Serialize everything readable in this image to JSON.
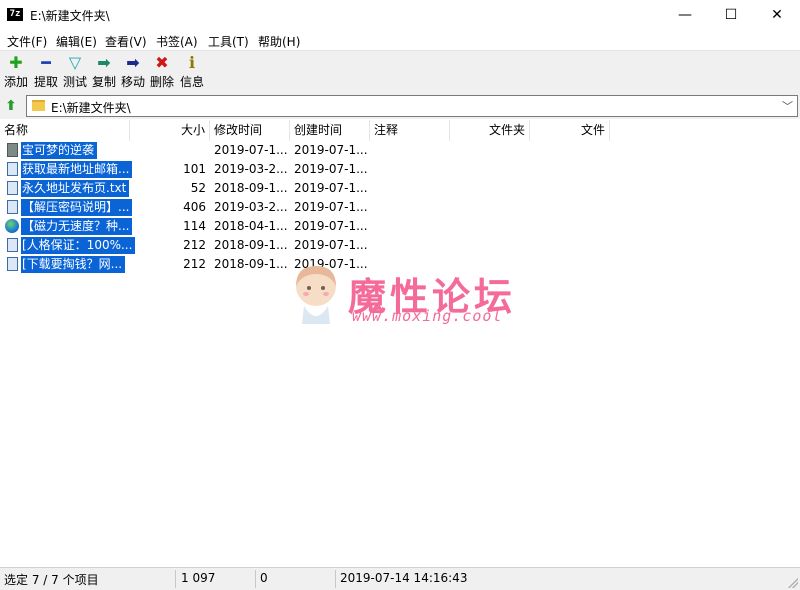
{
  "window": {
    "app_icon_text": "7z",
    "title": "E:\\新建文件夹\\",
    "controls": {
      "minimize": "—",
      "maximize": "☐",
      "close": "✕"
    }
  },
  "menu": [
    "文件(F)",
    "编辑(E)",
    "查看(V)",
    "书签(A)",
    "工具(T)",
    "帮助(H)"
  ],
  "toolbar": [
    {
      "label": "添加",
      "icon": "add-icon",
      "glyph": "✚",
      "color": "#1fa31f"
    },
    {
      "label": "提取",
      "icon": "extract-icon",
      "glyph": "━",
      "color": "#1c3fb8"
    },
    {
      "label": "测试",
      "icon": "test-icon",
      "glyph": "▽",
      "color": "#19a9b8"
    },
    {
      "label": "复制",
      "icon": "copy-icon",
      "glyph": "➡",
      "color": "#1c8a6a"
    },
    {
      "label": "移动",
      "icon": "move-icon",
      "glyph": "➡",
      "color": "#1c2a8a"
    },
    {
      "label": "删除",
      "icon": "delete-icon",
      "glyph": "✖",
      "color": "#d11414"
    },
    {
      "label": "信息",
      "icon": "info-icon",
      "glyph": "ℹ",
      "color": "#8a7a00"
    }
  ],
  "address": {
    "path": "E:\\新建文件夹\\"
  },
  "columns": {
    "name": "名称",
    "size": "大小",
    "modified": "修改时间",
    "created": "创建时间",
    "comment": "注释",
    "folders": "文件夹",
    "files": "文件"
  },
  "files": [
    {
      "name": "宝可梦的逆袭",
      "size": "",
      "modified": "2019-07-1...",
      "created": "2019-07-1...",
      "icon": "folder-icon"
    },
    {
      "name": "获取最新地址邮箱...",
      "size": "101",
      "modified": "2019-03-2...",
      "created": "2019-07-1...",
      "icon": "file-icon"
    },
    {
      "name": "永久地址发布页.txt",
      "size": "52",
      "modified": "2018-09-1...",
      "created": "2019-07-1...",
      "icon": "file-icon"
    },
    {
      "name": "【解压密码说明】...",
      "size": "406",
      "modified": "2019-03-2...",
      "created": "2019-07-1...",
      "icon": "file-icon"
    },
    {
      "name": "【磁力无速度？种...",
      "size": "114",
      "modified": "2018-04-1...",
      "created": "2019-07-1...",
      "icon": "globe-icon"
    },
    {
      "name": "[人格保证：100%...",
      "size": "212",
      "modified": "2018-09-1...",
      "created": "2019-07-1...",
      "icon": "file-icon"
    },
    {
      "name": "[下载要掏钱？网...",
      "size": "212",
      "modified": "2018-09-1...",
      "created": "2019-07-1...",
      "icon": "file-icon"
    }
  ],
  "watermark": {
    "title": "魔性论坛",
    "url": "www.moxing.cool"
  },
  "status": {
    "selection": "选定 7 / 7 个项目",
    "size": "1 097",
    "count": "0",
    "datetime": "2019-07-14 14:16:43"
  }
}
